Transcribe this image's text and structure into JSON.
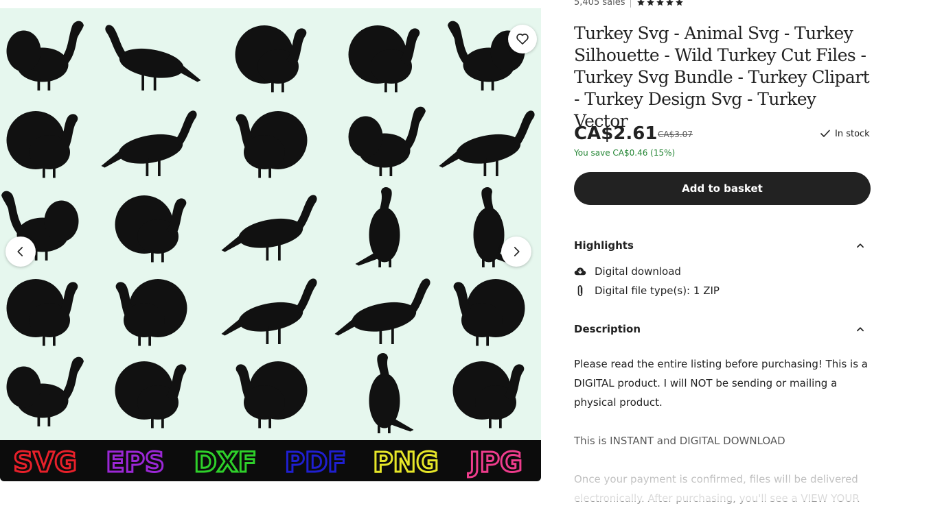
{
  "gallery": {
    "image_alt": "Grid of black turkey silhouettes on a pale mint background",
    "formats": [
      {
        "label": "SVG",
        "color": "#e8202a"
      },
      {
        "label": "EPS",
        "color": "#9b27d6"
      },
      {
        "label": "DXF",
        "color": "#2ed02a"
      },
      {
        "label": "PDF",
        "color": "#1f1fd0"
      },
      {
        "label": "PNG",
        "color": "#e6e628"
      },
      {
        "label": "JPG",
        "color": "#ee3c8c"
      }
    ],
    "favorite_icon": "heart-icon",
    "prev_icon": "chevron-left-icon",
    "next_icon": "chevron-right-icon",
    "background_color": "#e6f7ee"
  },
  "listing": {
    "sales": "5,405 sales",
    "rating": 5,
    "title": "Turkey Svg - Animal Svg - Turkey Silhouette - Wild Turkey Cut Files - Turkey Svg Bundle - Turkey Clipart - Turkey Design Svg - Turkey Vector",
    "price": "CA$2.61",
    "original_price": "CA$3.07",
    "stock": "In stock",
    "savings": "You save CA$0.46 (15%)",
    "add_to_basket": "Add to basket"
  },
  "highlights": {
    "heading": "Highlights",
    "items": [
      {
        "icon": "cloud-download-icon",
        "text": "Digital download"
      },
      {
        "icon": "paperclip-icon",
        "text": "Digital file type(s): 1 ZIP"
      }
    ]
  },
  "description": {
    "heading": "Description",
    "paragraphs": [
      "Please read the entire listing before purchasing! This is a DIGITAL product. I will NOT be sending or mailing a physical product.",
      "This is INSTANT and DIGITAL DOWNLOAD",
      "Once your payment is confirmed, files will be delivered electronically. After purchasing, you'll see a VIEW YOUR"
    ]
  },
  "colors": {
    "accent": "#222222",
    "savings_green": "#258635",
    "text_muted": "#595959"
  }
}
